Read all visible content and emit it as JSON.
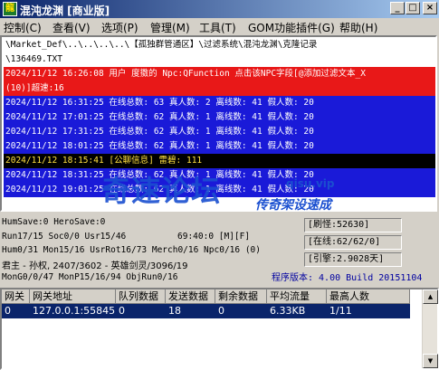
{
  "window": {
    "title": "混沌龙渊 [商业版]",
    "minimize": "_",
    "maximize": "□",
    "close": "×"
  },
  "menu": [
    {
      "label": "控制(C)"
    },
    {
      "label": "查看(V)"
    },
    {
      "label": "选项(P)"
    },
    {
      "label": "管理(M)"
    },
    {
      "label": "工具(T)"
    },
    {
      "label": "GOM功能插件(G)"
    },
    {
      "label": "帮助(H)"
    }
  ],
  "log": [
    {
      "text": "\\Market_Def\\..\\..\\..\\..\\【孤独群管通区】\\过滤系统\\混沌龙渊\\克隆记录",
      "style": "black"
    },
    {
      "text": "\\136469.TXT",
      "style": "black"
    },
    {
      "text": "2024/11/12 16:26:08 用户 度擞的 Npc:QFunction 点击该NPC字段[@添加过滤文本_X",
      "style": "red"
    },
    {
      "text": "(10)]超速:16",
      "style": "red"
    },
    {
      "text": "2024/11/12 16:31:25 在线总数: 63 真人数: 2 离线数: 41 假人数: 20",
      "style": "blue"
    },
    {
      "text": "2024/11/12 17:01:25 在线总数: 62 真人数: 1 离线数: 41 假人数: 20",
      "style": "blue"
    },
    {
      "text": "2024/11/12 17:31:25 在线总数: 62 真人数: 1 离线数: 41 假人数: 20",
      "style": "blue"
    },
    {
      "text": "2024/11/12 18:01:25 在线总数: 62 真人数: 1 离线数: 41 假人数: 20",
      "style": "blue"
    },
    {
      "text": "2024/11/12 18:15:41 [公聊信息] 雷碧: 111",
      "style": "yellow"
    },
    {
      "text": "2024/11/12 18:31:25 在线总数: 62 真人数: 1 离线数: 41 假人数: 20",
      "style": "blue"
    },
    {
      "text": "2024/11/12 19:01:25 在线总数: 62 真人数: 1 离线数: 41 假人数: 20",
      "style": "blue"
    }
  ],
  "watermark": {
    "main": "奇速论坛",
    "url": "qisu.vip",
    "sub": "传奇架设速成"
  },
  "status": {
    "line1": "HumSave:0 HeroSave:0",
    "line2": "Run17/15 Soc0/0 Usr15/46",
    "line2b": "69:40:0 [M][F]",
    "line3": "Hum0/31 Mon15/16 UsrRot16/73 Merch0/16 Npc0/16 (0)",
    "line4": "君主 - 孙权, 2407/3602 - 英雄剑灵/3096/19",
    "line5": "MonG0/0/47 MonP15/16/94 ObjRun0/16",
    "memory": "[刷怪:52630]",
    "online": "[在线:62/62/0]",
    "uptime": "[引擎:2.9028天]",
    "version": "程序版本: 4.00 Build 20151104"
  },
  "table": {
    "headers": [
      "网关",
      "网关地址",
      "队列数据",
      "发送数据",
      "剩余数据",
      "平均流量",
      "最高人数"
    ],
    "rows": [
      [
        "0",
        "127.0.0.1:55845",
        "0",
        "18",
        "0",
        "6.33KB",
        "1/11"
      ]
    ]
  }
}
